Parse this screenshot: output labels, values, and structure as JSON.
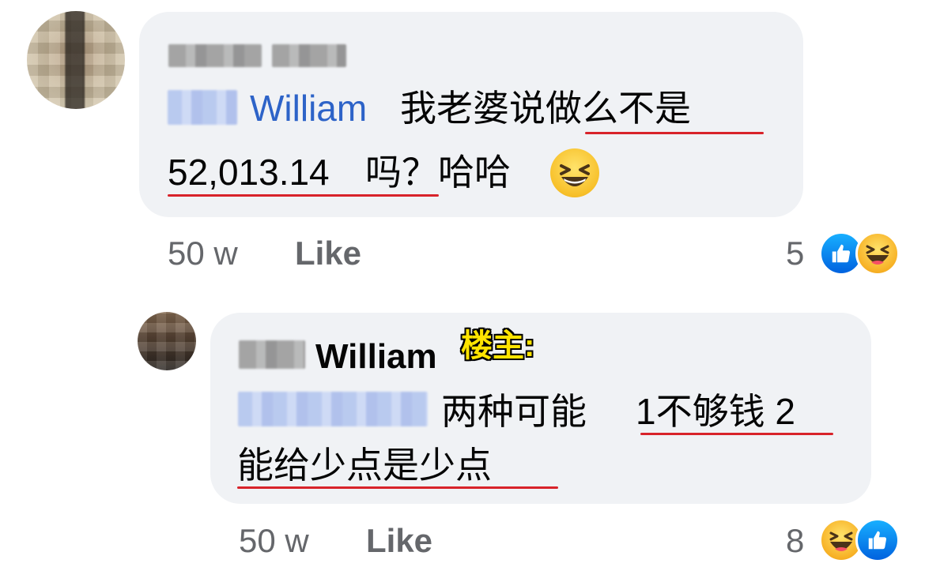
{
  "comments": [
    {
      "author_name_redacted": true,
      "mention_redacted": true,
      "mention_name": "William",
      "text_line1": "我老婆说做么不是",
      "text_line2_number": "52,013.14",
      "text_line2_rest": "吗？哈哈",
      "emoji_name": "grinning-squinting-face-icon",
      "time": "50 w",
      "like_label": "Like",
      "reaction_count": "5",
      "reactions": [
        "like-reaction-icon",
        "haha-reaction-icon"
      ]
    },
    {
      "author_name_redacted": true,
      "author_first": "William",
      "op_tag": "楼主:",
      "mention_redacted": true,
      "text_line1": "两种可能",
      "text_line1_b": "1不够钱 2",
      "text_line2": "能给少点是少点",
      "time": "50 w",
      "like_label": "Like",
      "reaction_count": "8",
      "reactions": [
        "haha-reaction-icon",
        "like-reaction-icon"
      ]
    }
  ],
  "colors": {
    "bubble": "#f0f2f5",
    "mention": "#2d63c8",
    "underline": "#d8232a",
    "meta": "#65676b",
    "op_tag": "#ffe400"
  }
}
